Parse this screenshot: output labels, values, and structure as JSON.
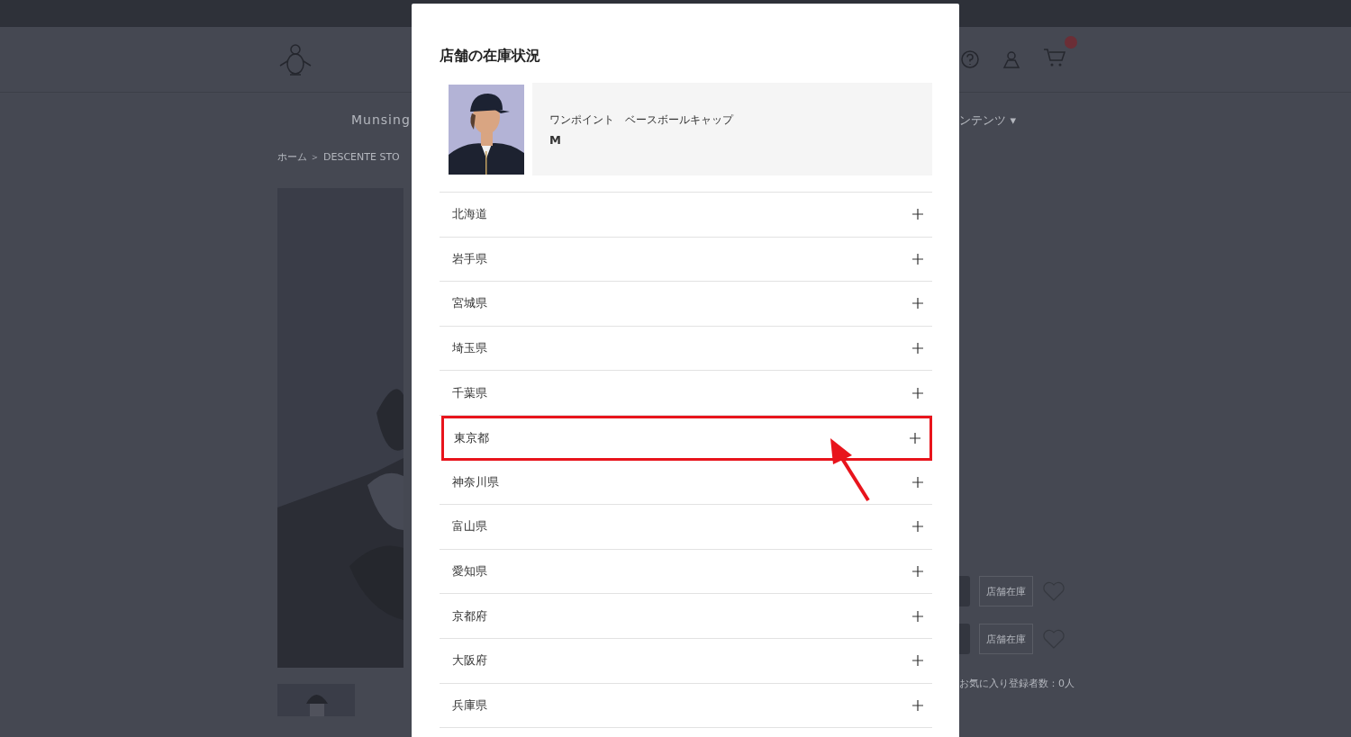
{
  "page": {
    "nav_items": [
      "Munsing",
      "ンテンツ ▾"
    ],
    "breadcrumb": "ホーム ＞ DESCENTE STO",
    "stock_buttons": [
      "店舗在庫",
      "店舗在庫"
    ],
    "favorites": "お気に入り登録者数：0人"
  },
  "modal": {
    "title": "店舗の在庫状況",
    "product": {
      "name": "ワンポイント　ベースボールキャップ",
      "size": "M"
    },
    "prefectures": [
      {
        "name": "北海道",
        "highlighted": false
      },
      {
        "name": "岩手県",
        "highlighted": false
      },
      {
        "name": "宮城県",
        "highlighted": false
      },
      {
        "name": "埼玉県",
        "highlighted": false
      },
      {
        "name": "千葉県",
        "highlighted": false
      },
      {
        "name": "東京都",
        "highlighted": true
      },
      {
        "name": "神奈川県",
        "highlighted": false
      },
      {
        "name": "富山県",
        "highlighted": false
      },
      {
        "name": "愛知県",
        "highlighted": false
      },
      {
        "name": "京都府",
        "highlighted": false
      },
      {
        "name": "大阪府",
        "highlighted": false
      },
      {
        "name": "兵庫県",
        "highlighted": false
      }
    ]
  }
}
